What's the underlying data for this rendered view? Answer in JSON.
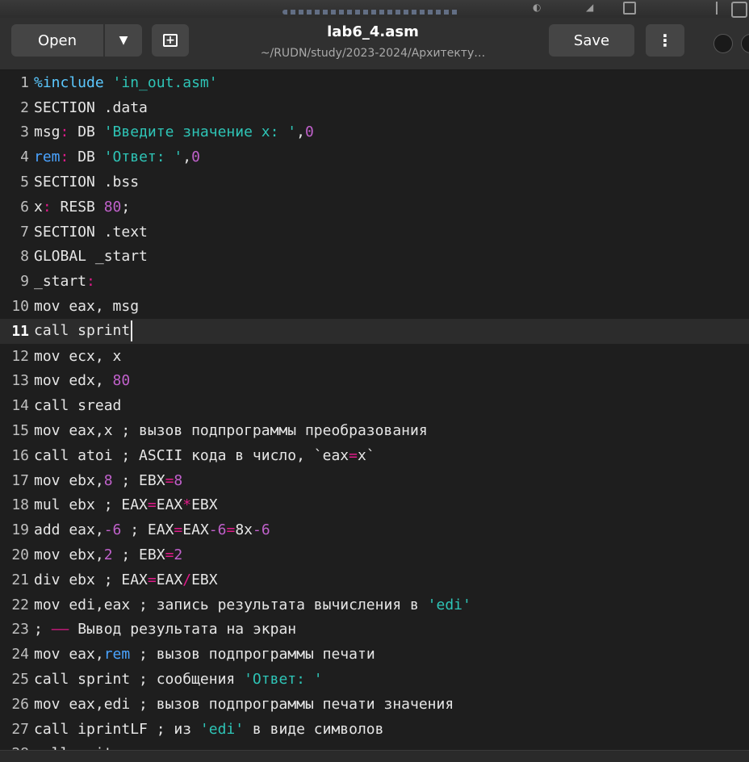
{
  "window": {
    "title": "lab6_4.asm",
    "subtitle": "~/RUDN/study/2023-2024/Архитекту…"
  },
  "header": {
    "open_label": "Open",
    "save_label": "Save"
  },
  "icons": {
    "dropdown": "chevron-down-icon",
    "new_tab": "new-document-icon",
    "menu": "kebab-menu-icon"
  },
  "colors": {
    "default": "#e6e6e6",
    "string": "#2ec4b6",
    "number": "#c061cb",
    "operator": "#e01b8a",
    "preproc": "#5bc8ff",
    "ident": "#4aa3ff"
  },
  "editor": {
    "current_line": 11,
    "lines": [
      [
        [
          "pp",
          "%include"
        ],
        [
          "t",
          " "
        ],
        [
          "s",
          "'in_out.asm'"
        ]
      ],
      [
        [
          "t",
          "SECTION .data"
        ]
      ],
      [
        [
          "t",
          "msg"
        ],
        [
          "o",
          ":"
        ],
        [
          "t",
          " DB "
        ],
        [
          "s",
          "'Введите значение x: '"
        ],
        [
          "t",
          ","
        ],
        [
          "n",
          "0"
        ]
      ],
      [
        [
          "id",
          "rem"
        ],
        [
          "o",
          ":"
        ],
        [
          "t",
          " DB "
        ],
        [
          "s",
          "'Ответ: '"
        ],
        [
          "t",
          ","
        ],
        [
          "n",
          "0"
        ]
      ],
      [
        [
          "t",
          "SECTION .bss"
        ]
      ],
      [
        [
          "t",
          "x"
        ],
        [
          "o",
          ":"
        ],
        [
          "t",
          " RESB "
        ],
        [
          "n",
          "80"
        ],
        [
          "t",
          ";"
        ]
      ],
      [
        [
          "t",
          "SECTION .text"
        ]
      ],
      [
        [
          "t",
          "GLOBAL _start"
        ]
      ],
      [
        [
          "t",
          "_start"
        ],
        [
          "o",
          ":"
        ]
      ],
      [
        [
          "t",
          "mov eax, msg"
        ]
      ],
      [
        [
          "t",
          "call sprint"
        ]
      ],
      [
        [
          "t",
          "mov ecx, x"
        ]
      ],
      [
        [
          "t",
          "mov edx, "
        ],
        [
          "n",
          "80"
        ]
      ],
      [
        [
          "t",
          "call sread"
        ]
      ],
      [
        [
          "t",
          "mov eax,x ; вызов подпрограммы преобразования"
        ]
      ],
      [
        [
          "t",
          "call atoi ; ASCII кода в число, `eax"
        ],
        [
          "o",
          "="
        ],
        [
          "t",
          "x`"
        ]
      ],
      [
        [
          "t",
          "mov ebx,"
        ],
        [
          "n",
          "8"
        ],
        [
          "t",
          " ; EBX"
        ],
        [
          "o",
          "="
        ],
        [
          "n",
          "8"
        ]
      ],
      [
        [
          "t",
          "mul ebx ; EAX"
        ],
        [
          "o",
          "="
        ],
        [
          "t",
          "EAX"
        ],
        [
          "o",
          "*"
        ],
        [
          "t",
          "EBX"
        ]
      ],
      [
        [
          "t",
          "add eax,"
        ],
        [
          "n",
          "-6"
        ],
        [
          "t",
          " ; EAX"
        ],
        [
          "o",
          "="
        ],
        [
          "t",
          "EAX"
        ],
        [
          "n",
          "-6"
        ],
        [
          "o",
          "="
        ],
        [
          "t",
          "8x"
        ],
        [
          "n",
          "-6"
        ]
      ],
      [
        [
          "t",
          "mov ebx,"
        ],
        [
          "n",
          "2"
        ],
        [
          "t",
          " ; EBX"
        ],
        [
          "o",
          "="
        ],
        [
          "n",
          "2"
        ]
      ],
      [
        [
          "t",
          "div ebx ; EAX"
        ],
        [
          "o",
          "="
        ],
        [
          "t",
          "EAX"
        ],
        [
          "o",
          "/"
        ],
        [
          "t",
          "EBX"
        ]
      ],
      [
        [
          "t",
          "mov edi,eax ; запись результата вычисления в "
        ],
        [
          "s",
          "'edi'"
        ]
      ],
      [
        [
          "t",
          "; "
        ],
        [
          "o",
          "——"
        ],
        [
          "t",
          " Вывод результата на экран"
        ]
      ],
      [
        [
          "t",
          "mov eax,"
        ],
        [
          "id",
          "rem"
        ],
        [
          "t",
          " ; вызов подпрограммы печати"
        ]
      ],
      [
        [
          "t",
          "call sprint ; сообщения "
        ],
        [
          "s",
          "'Ответ: '"
        ]
      ],
      [
        [
          "t",
          "mov eax,edi ; вызов подпрограммы печати значения"
        ]
      ],
      [
        [
          "t",
          "call iprintLF ; из "
        ],
        [
          "s",
          "'edi'"
        ],
        [
          "t",
          " в виде символов"
        ]
      ],
      [
        [
          "t",
          "call quit ; вызов подпрограммы завершения"
        ]
      ]
    ]
  }
}
